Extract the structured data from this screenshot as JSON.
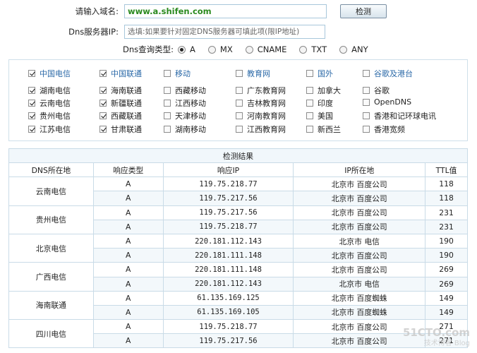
{
  "form": {
    "domain_label": "请输入域名:",
    "domain_value": "www.a.shifen.com",
    "check_button": "检测",
    "dns_label": "Dns服务器IP:",
    "dns_placeholder": "选填:如果要针对固定DNS服务器可填此项(限IP地址)",
    "type_label": "Dns查询类型:",
    "types": [
      {
        "label": "A",
        "selected": true
      },
      {
        "label": "MX",
        "selected": false
      },
      {
        "label": "CNAME",
        "selected": false
      },
      {
        "label": "TXT",
        "selected": false
      },
      {
        "label": "ANY",
        "selected": false
      }
    ]
  },
  "isp_columns": [
    {
      "head": "中国电信",
      "head_checked": true,
      "items": [
        {
          "label": "湖南电信",
          "checked": true
        },
        {
          "label": "云南电信",
          "checked": true
        },
        {
          "label": "贵州电信",
          "checked": true
        },
        {
          "label": "江苏电信",
          "checked": true
        }
      ]
    },
    {
      "head": "中国联通",
      "head_checked": true,
      "items": [
        {
          "label": "海南联通",
          "checked": true
        },
        {
          "label": "新疆联通",
          "checked": true
        },
        {
          "label": "西藏联通",
          "checked": true
        },
        {
          "label": "甘肃联通",
          "checked": true
        }
      ]
    },
    {
      "head": "移动",
      "head_checked": false,
      "items": [
        {
          "label": "西藏移动",
          "checked": false
        },
        {
          "label": "江西移动",
          "checked": false
        },
        {
          "label": "天津移动",
          "checked": false
        },
        {
          "label": "湖南移动",
          "checked": false
        }
      ]
    },
    {
      "head": "教育网",
      "head_checked": false,
      "items": [
        {
          "label": "广东教育网",
          "checked": false
        },
        {
          "label": "吉林教育网",
          "checked": false
        },
        {
          "label": "河南教育网",
          "checked": false
        },
        {
          "label": "江西教育网",
          "checked": false
        }
      ]
    },
    {
      "head": "国外",
      "head_checked": false,
      "items": [
        {
          "label": "加拿大",
          "checked": false
        },
        {
          "label": "印度",
          "checked": false
        },
        {
          "label": "美国",
          "checked": false
        },
        {
          "label": "新西兰",
          "checked": false
        }
      ]
    },
    {
      "head": "谷歌及港台",
      "head_checked": false,
      "items": [
        {
          "label": "谷歌",
          "checked": false
        },
        {
          "label": "OpenDNS",
          "checked": false
        },
        {
          "label": "香港和记环球电讯",
          "checked": false
        },
        {
          "label": "香港宽频",
          "checked": false
        }
      ]
    }
  ],
  "results": {
    "caption": "检测结果",
    "headers": [
      "DNS所在地",
      "响应类型",
      "响应IP",
      "IP所在地",
      "TTL值"
    ],
    "groups": [
      {
        "location": "云南电信",
        "rows": [
          [
            "A",
            "119.75.218.77",
            "北京市 百度公司",
            "118"
          ],
          [
            "A",
            "119.75.217.56",
            "北京市 百度公司",
            "118"
          ]
        ]
      },
      {
        "location": "贵州电信",
        "rows": [
          [
            "A",
            "119.75.217.56",
            "北京市 百度公司",
            "231"
          ],
          [
            "A",
            "119.75.218.77",
            "北京市 百度公司",
            "231"
          ]
        ]
      },
      {
        "location": "北京电信",
        "rows": [
          [
            "A",
            "220.181.112.143",
            "北京市 电信",
            "190"
          ],
          [
            "A",
            "220.181.111.148",
            "北京市 百度公司",
            "190"
          ]
        ]
      },
      {
        "location": "广西电信",
        "rows": [
          [
            "A",
            "220.181.111.148",
            "北京市 百度公司",
            "269"
          ],
          [
            "A",
            "220.181.112.143",
            "北京市 电信",
            "269"
          ]
        ]
      },
      {
        "location": "海南联通",
        "rows": [
          [
            "A",
            "61.135.169.125",
            "北京市 百度蜘蛛",
            "149"
          ],
          [
            "A",
            "61.135.169.105",
            "北京市 百度蜘蛛",
            "149"
          ]
        ]
      },
      {
        "location": "四川电信",
        "rows": [
          [
            "A",
            "119.75.218.77",
            "北京市 百度公司",
            "271"
          ],
          [
            "A",
            "119.75.217.56",
            "北京市 百度公司",
            "271"
          ]
        ]
      }
    ]
  },
  "watermark": {
    "line1": "51CTO.com",
    "line2": "技术博客 Blog"
  }
}
